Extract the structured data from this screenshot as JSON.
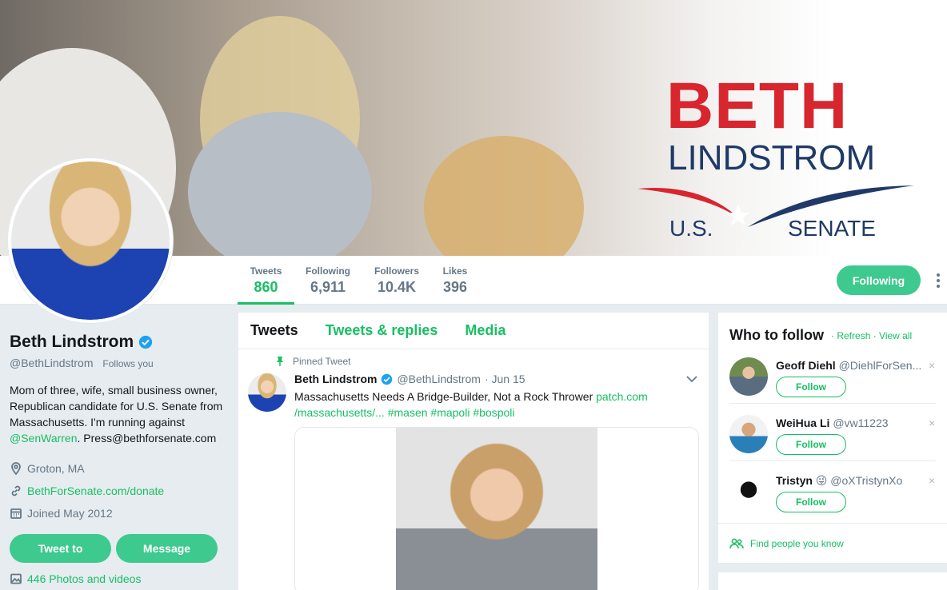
{
  "banner": {
    "brand_first": "BETH",
    "brand_last": "LINDSTROM",
    "brand_us": "U.S.",
    "brand_senate": "SENATE",
    "colors": {
      "red": "#d7262e",
      "navy": "#1f3a68"
    }
  },
  "nav": {
    "stats": [
      {
        "label": "Tweets",
        "value": "860",
        "active": true
      },
      {
        "label": "Following",
        "value": "6,911"
      },
      {
        "label": "Followers",
        "value": "10.4K"
      },
      {
        "label": "Likes",
        "value": "396"
      }
    ],
    "following_label": "Following",
    "accent": "#17bf63"
  },
  "profile": {
    "name": "Beth Lindstrom",
    "handle": "@BethLindstrom",
    "follows_you": "Follows you",
    "bio_text": "Mom of three, wife, small business owner, Republican candidate for U.S. Senate from Massachusetts. I'm running against ",
    "bio_mention": "@SenWarren",
    "bio_tail": ". Press@bethforsenate.com",
    "location": "Groton, MA",
    "website": "BethForSenate.com/donate",
    "joined": "Joined May 2012",
    "tweet_to_label": "Tweet to",
    "message_label": "Message",
    "photos_label": "446 Photos and videos"
  },
  "timeline": {
    "tabs": [
      "Tweets",
      "Tweets & replies",
      "Media"
    ],
    "pinned_label": "Pinned Tweet",
    "tweet": {
      "name": "Beth Lindstrom",
      "handle": "@BethLindstrom",
      "date": "· Jun 15",
      "text": "Massachusetts Needs A Bridge-Builder, Not a Rock Thrower ",
      "link1": "patch.com",
      "link2": "/massachusetts/...",
      "hashtags": " #masen #mapoli #bospoli"
    }
  },
  "who_to_follow": {
    "title": "Who to follow",
    "sep": " · ",
    "refresh": "Refresh",
    "view_all": "View all",
    "follow_label": "Follow",
    "suggestions": [
      {
        "name": "Geoff Diehl",
        "handle": "@DiehlForSen..."
      },
      {
        "name": "WeiHua Li",
        "handle": "@vw11223"
      },
      {
        "name": "Tristyn",
        "emoji": "😜",
        "handle": "@oXTristynXo"
      }
    ],
    "close_glyph": "×",
    "find_people": "Find people you know"
  }
}
